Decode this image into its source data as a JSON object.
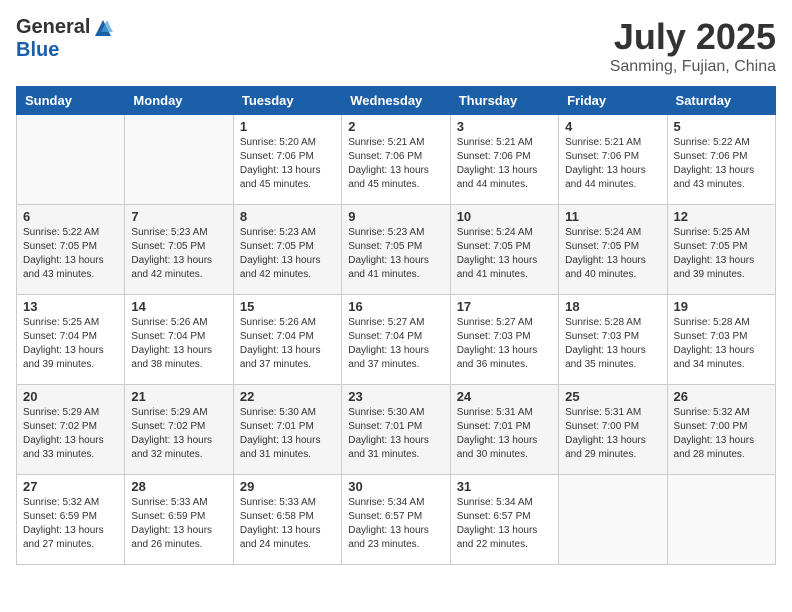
{
  "header": {
    "logo_general": "General",
    "logo_blue": "Blue",
    "title": "July 2025",
    "location": "Sanming, Fujian, China"
  },
  "calendar": {
    "headers": [
      "Sunday",
      "Monday",
      "Tuesday",
      "Wednesday",
      "Thursday",
      "Friday",
      "Saturday"
    ],
    "weeks": [
      [
        {
          "day": "",
          "info": ""
        },
        {
          "day": "",
          "info": ""
        },
        {
          "day": "1",
          "info": "Sunrise: 5:20 AM\nSunset: 7:06 PM\nDaylight: 13 hours and 45 minutes."
        },
        {
          "day": "2",
          "info": "Sunrise: 5:21 AM\nSunset: 7:06 PM\nDaylight: 13 hours and 45 minutes."
        },
        {
          "day": "3",
          "info": "Sunrise: 5:21 AM\nSunset: 7:06 PM\nDaylight: 13 hours and 44 minutes."
        },
        {
          "day": "4",
          "info": "Sunrise: 5:21 AM\nSunset: 7:06 PM\nDaylight: 13 hours and 44 minutes."
        },
        {
          "day": "5",
          "info": "Sunrise: 5:22 AM\nSunset: 7:06 PM\nDaylight: 13 hours and 43 minutes."
        }
      ],
      [
        {
          "day": "6",
          "info": "Sunrise: 5:22 AM\nSunset: 7:05 PM\nDaylight: 13 hours and 43 minutes."
        },
        {
          "day": "7",
          "info": "Sunrise: 5:23 AM\nSunset: 7:05 PM\nDaylight: 13 hours and 42 minutes."
        },
        {
          "day": "8",
          "info": "Sunrise: 5:23 AM\nSunset: 7:05 PM\nDaylight: 13 hours and 42 minutes."
        },
        {
          "day": "9",
          "info": "Sunrise: 5:23 AM\nSunset: 7:05 PM\nDaylight: 13 hours and 41 minutes."
        },
        {
          "day": "10",
          "info": "Sunrise: 5:24 AM\nSunset: 7:05 PM\nDaylight: 13 hours and 41 minutes."
        },
        {
          "day": "11",
          "info": "Sunrise: 5:24 AM\nSunset: 7:05 PM\nDaylight: 13 hours and 40 minutes."
        },
        {
          "day": "12",
          "info": "Sunrise: 5:25 AM\nSunset: 7:05 PM\nDaylight: 13 hours and 39 minutes."
        }
      ],
      [
        {
          "day": "13",
          "info": "Sunrise: 5:25 AM\nSunset: 7:04 PM\nDaylight: 13 hours and 39 minutes."
        },
        {
          "day": "14",
          "info": "Sunrise: 5:26 AM\nSunset: 7:04 PM\nDaylight: 13 hours and 38 minutes."
        },
        {
          "day": "15",
          "info": "Sunrise: 5:26 AM\nSunset: 7:04 PM\nDaylight: 13 hours and 37 minutes."
        },
        {
          "day": "16",
          "info": "Sunrise: 5:27 AM\nSunset: 7:04 PM\nDaylight: 13 hours and 37 minutes."
        },
        {
          "day": "17",
          "info": "Sunrise: 5:27 AM\nSunset: 7:03 PM\nDaylight: 13 hours and 36 minutes."
        },
        {
          "day": "18",
          "info": "Sunrise: 5:28 AM\nSunset: 7:03 PM\nDaylight: 13 hours and 35 minutes."
        },
        {
          "day": "19",
          "info": "Sunrise: 5:28 AM\nSunset: 7:03 PM\nDaylight: 13 hours and 34 minutes."
        }
      ],
      [
        {
          "day": "20",
          "info": "Sunrise: 5:29 AM\nSunset: 7:02 PM\nDaylight: 13 hours and 33 minutes."
        },
        {
          "day": "21",
          "info": "Sunrise: 5:29 AM\nSunset: 7:02 PM\nDaylight: 13 hours and 32 minutes."
        },
        {
          "day": "22",
          "info": "Sunrise: 5:30 AM\nSunset: 7:01 PM\nDaylight: 13 hours and 31 minutes."
        },
        {
          "day": "23",
          "info": "Sunrise: 5:30 AM\nSunset: 7:01 PM\nDaylight: 13 hours and 31 minutes."
        },
        {
          "day": "24",
          "info": "Sunrise: 5:31 AM\nSunset: 7:01 PM\nDaylight: 13 hours and 30 minutes."
        },
        {
          "day": "25",
          "info": "Sunrise: 5:31 AM\nSunset: 7:00 PM\nDaylight: 13 hours and 29 minutes."
        },
        {
          "day": "26",
          "info": "Sunrise: 5:32 AM\nSunset: 7:00 PM\nDaylight: 13 hours and 28 minutes."
        }
      ],
      [
        {
          "day": "27",
          "info": "Sunrise: 5:32 AM\nSunset: 6:59 PM\nDaylight: 13 hours and 27 minutes."
        },
        {
          "day": "28",
          "info": "Sunrise: 5:33 AM\nSunset: 6:59 PM\nDaylight: 13 hours and 26 minutes."
        },
        {
          "day": "29",
          "info": "Sunrise: 5:33 AM\nSunset: 6:58 PM\nDaylight: 13 hours and 24 minutes."
        },
        {
          "day": "30",
          "info": "Sunrise: 5:34 AM\nSunset: 6:57 PM\nDaylight: 13 hours and 23 minutes."
        },
        {
          "day": "31",
          "info": "Sunrise: 5:34 AM\nSunset: 6:57 PM\nDaylight: 13 hours and 22 minutes."
        },
        {
          "day": "",
          "info": ""
        },
        {
          "day": "",
          "info": ""
        }
      ]
    ]
  }
}
